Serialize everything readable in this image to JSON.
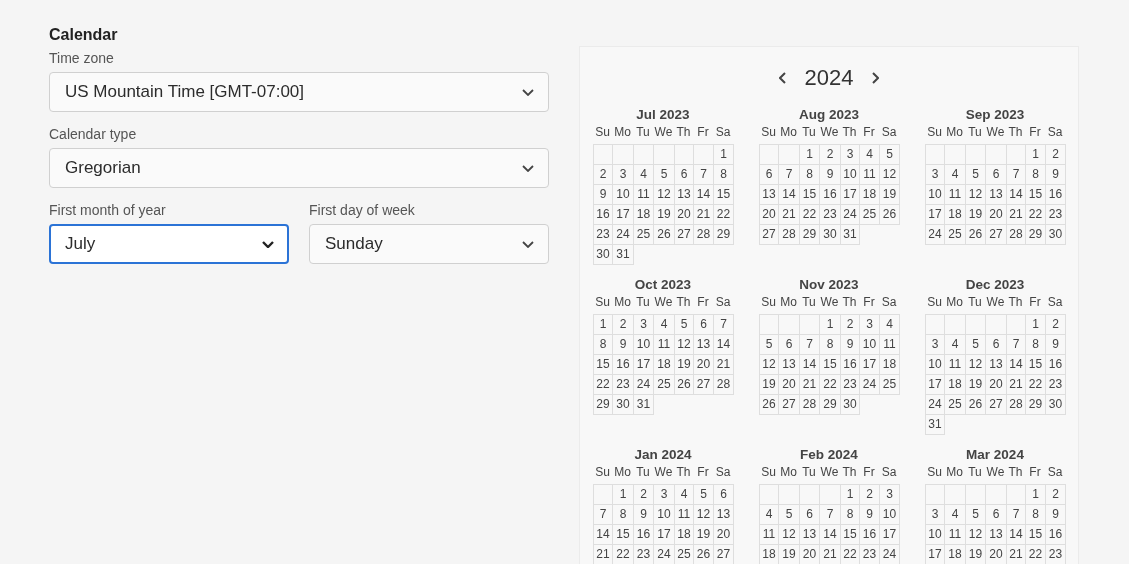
{
  "section_title": "Calendar",
  "fields": [
    {
      "label": "Time zone",
      "value": "US Mountain Time [GMT-07:00]",
      "focused": false,
      "kind": "full"
    },
    {
      "label": "Calendar type",
      "value": "Gregorian",
      "focused": false,
      "kind": "full"
    },
    {
      "label": "First month of year",
      "value": "July",
      "focused": true,
      "kind": "half"
    },
    {
      "label": "First day of week",
      "value": "Sunday",
      "focused": false,
      "kind": "half"
    }
  ],
  "preview": {
    "year": "2024",
    "months": [
      {
        "title": "Jul 2023",
        "weekdays": [
          "Su",
          "Mo",
          "Tu",
          "We",
          "Th",
          "Fr",
          "Sa"
        ],
        "weeks": [
          [
            {
              "kind": "blank"
            },
            {
              "kind": "blank"
            },
            {
              "kind": "blank"
            },
            {
              "kind": "blank"
            },
            {
              "kind": "blank"
            },
            {
              "kind": "blank"
            },
            "1"
          ],
          [
            "2",
            "3",
            "4",
            "5",
            "6",
            "7",
            "8"
          ],
          [
            "9",
            "10",
            "11",
            "12",
            "13",
            "14",
            "15"
          ],
          [
            "16",
            "17",
            "18",
            "19",
            "20",
            "21",
            "22"
          ],
          [
            "23",
            "24",
            "25",
            "26",
            "27",
            "28",
            "29"
          ],
          [
            "30",
            "31"
          ]
        ]
      },
      {
        "title": "Aug 2023",
        "weekdays": [
          "Su",
          "Mo",
          "Tu",
          "We",
          "Th",
          "Fr",
          "Sa"
        ],
        "weeks": [
          [
            {
              "kind": "blank"
            },
            {
              "kind": "blank"
            },
            "1",
            "2",
            "3",
            "4",
            "5"
          ],
          [
            "6",
            "7",
            "8",
            "9",
            "10",
            "11",
            "12"
          ],
          [
            "13",
            "14",
            "15",
            "16",
            "17",
            "18",
            "19"
          ],
          [
            "20",
            "21",
            "22",
            "23",
            "24",
            "25",
            "26"
          ],
          [
            "27",
            "28",
            "29",
            "30",
            "31"
          ]
        ]
      },
      {
        "title": "Sep 2023",
        "weekdays": [
          "Su",
          "Mo",
          "Tu",
          "We",
          "Th",
          "Fr",
          "Sa"
        ],
        "weeks": [
          [
            {
              "kind": "blank"
            },
            {
              "kind": "blank"
            },
            {
              "kind": "blank"
            },
            {
              "kind": "blank"
            },
            {
              "kind": "blank"
            },
            "1",
            "2"
          ],
          [
            "3",
            "4",
            "5",
            "6",
            "7",
            "8",
            "9"
          ],
          [
            "10",
            "11",
            "12",
            "13",
            "14",
            "15",
            "16"
          ],
          [
            "17",
            "18",
            "19",
            "20",
            "21",
            "22",
            "23"
          ],
          [
            "24",
            "25",
            "26",
            "27",
            "28",
            "29",
            "30"
          ]
        ]
      },
      {
        "title": "Oct 2023",
        "weekdays": [
          "Su",
          "Mo",
          "Tu",
          "We",
          "Th",
          "Fr",
          "Sa"
        ],
        "weeks": [
          [
            "1",
            "2",
            "3",
            "4",
            "5",
            "6",
            "7"
          ],
          [
            "8",
            "9",
            "10",
            "11",
            "12",
            "13",
            "14"
          ],
          [
            "15",
            "16",
            "17",
            "18",
            "19",
            "20",
            "21"
          ],
          [
            "22",
            "23",
            "24",
            "25",
            "26",
            "27",
            "28"
          ],
          [
            "29",
            "30",
            "31"
          ]
        ]
      },
      {
        "title": "Nov 2023",
        "weekdays": [
          "Su",
          "Mo",
          "Tu",
          "We",
          "Th",
          "Fr",
          "Sa"
        ],
        "weeks": [
          [
            {
              "kind": "blank"
            },
            {
              "kind": "blank"
            },
            {
              "kind": "blank"
            },
            "1",
            "2",
            "3",
            "4"
          ],
          [
            "5",
            "6",
            "7",
            "8",
            "9",
            "10",
            "11"
          ],
          [
            "12",
            "13",
            "14",
            "15",
            "16",
            "17",
            "18"
          ],
          [
            "19",
            "20",
            "21",
            "22",
            "23",
            "24",
            "25"
          ],
          [
            "26",
            "27",
            "28",
            "29",
            "30"
          ]
        ]
      },
      {
        "title": "Dec 2023",
        "weekdays": [
          "Su",
          "Mo",
          "Tu",
          "We",
          "Th",
          "Fr",
          "Sa"
        ],
        "weeks": [
          [
            {
              "kind": "blank"
            },
            {
              "kind": "blank"
            },
            {
              "kind": "blank"
            },
            {
              "kind": "blank"
            },
            {
              "kind": "blank"
            },
            "1",
            "2"
          ],
          [
            "3",
            "4",
            "5",
            "6",
            "7",
            "8",
            "9"
          ],
          [
            "10",
            "11",
            "12",
            "13",
            "14",
            "15",
            "16"
          ],
          [
            "17",
            "18",
            "19",
            "20",
            "21",
            "22",
            "23"
          ],
          [
            "24",
            "25",
            "26",
            "27",
            "28",
            "29",
            "30"
          ],
          [
            "31"
          ]
        ]
      },
      {
        "title": "Jan 2024",
        "weekdays": [
          "Su",
          "Mo",
          "Tu",
          "We",
          "Th",
          "Fr",
          "Sa"
        ],
        "weeks": [
          [
            {
              "kind": "blank"
            },
            "1",
            "2",
            "3",
            "4",
            "5",
            "6"
          ],
          [
            "7",
            "8",
            "9",
            "10",
            "11",
            "12",
            "13"
          ],
          [
            "14",
            "15",
            "16",
            "17",
            "18",
            "19",
            "20"
          ],
          [
            "21",
            "22",
            "23",
            "24",
            "25",
            "26",
            "27"
          ]
        ]
      },
      {
        "title": "Feb 2024",
        "weekdays": [
          "Su",
          "Mo",
          "Tu",
          "We",
          "Th",
          "Fr",
          "Sa"
        ],
        "weeks": [
          [
            {
              "kind": "blank"
            },
            {
              "kind": "blank"
            },
            {
              "kind": "blank"
            },
            {
              "kind": "blank"
            },
            "1",
            "2",
            "3"
          ],
          [
            "4",
            "5",
            "6",
            "7",
            "8",
            "9",
            "10"
          ],
          [
            "11",
            "12",
            "13",
            "14",
            "15",
            "16",
            "17"
          ],
          [
            "18",
            "19",
            "20",
            "21",
            "22",
            "23",
            "24"
          ]
        ]
      },
      {
        "title": "Mar 2024",
        "weekdays": [
          "Su",
          "Mo",
          "Tu",
          "We",
          "Th",
          "Fr",
          "Sa"
        ],
        "weeks": [
          [
            {
              "kind": "blank"
            },
            {
              "kind": "blank"
            },
            {
              "kind": "blank"
            },
            {
              "kind": "blank"
            },
            {
              "kind": "blank"
            },
            "1",
            "2"
          ],
          [
            "3",
            "4",
            "5",
            "6",
            "7",
            "8",
            "9"
          ],
          [
            "10",
            "11",
            "12",
            "13",
            "14",
            "15",
            "16"
          ],
          [
            "17",
            "18",
            "19",
            "20",
            "21",
            "22",
            "23"
          ]
        ]
      }
    ]
  }
}
